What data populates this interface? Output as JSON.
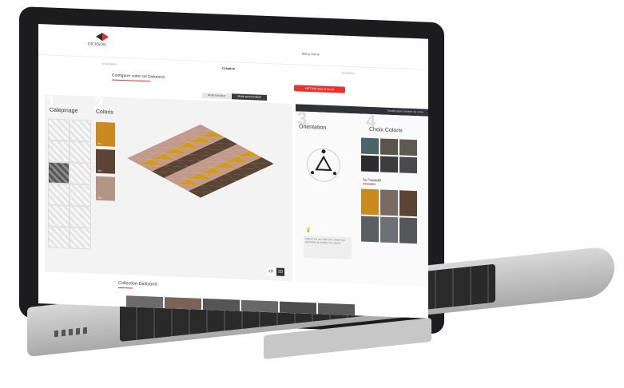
{
  "header": {
    "logo_text": "DICKSON",
    "menu_label": "Menu Home"
  },
  "steps": [
    "Inspiration",
    "Création",
    "Finalisez"
  ],
  "configurator": {
    "title": "Configurer votre sol Dickson®",
    "cta": "METTRE dans le Devis"
  },
  "mode_tabs": [
    "Mode baroque",
    "Mode personnalisé"
  ],
  "sections": {
    "calepinage": {
      "number": "1",
      "title": "Calepinage"
    },
    "coloris": {
      "number": "2",
      "title": "Coloris"
    },
    "orientation": {
      "number": "3",
      "title": "Orientation"
    },
    "choix_coloris": {
      "number": "4",
      "title": "Choix Coloris"
    }
  },
  "coloris_swatches": [
    {
      "label": "757",
      "color": "#c98a1e"
    },
    {
      "label": "758",
      "color": "#5b4336"
    },
    {
      "label": "759",
      "color": "#b39583"
    }
  ],
  "view_toggle": {
    "twod": "2D",
    "threed": "3D"
  },
  "right_bar": {
    "text": "Modification Unitées de votre"
  },
  "so_tweed_label": "So Tweed®",
  "tip_text": "Cliquez sur une dalle pour choisir son orientation et modifier son coloris",
  "collection_title": "Collection Dickson®",
  "colors": {
    "accent": "#e8332e",
    "mustard": "#d39a20",
    "brown": "#5a4535",
    "pink": "#c29a8c"
  }
}
